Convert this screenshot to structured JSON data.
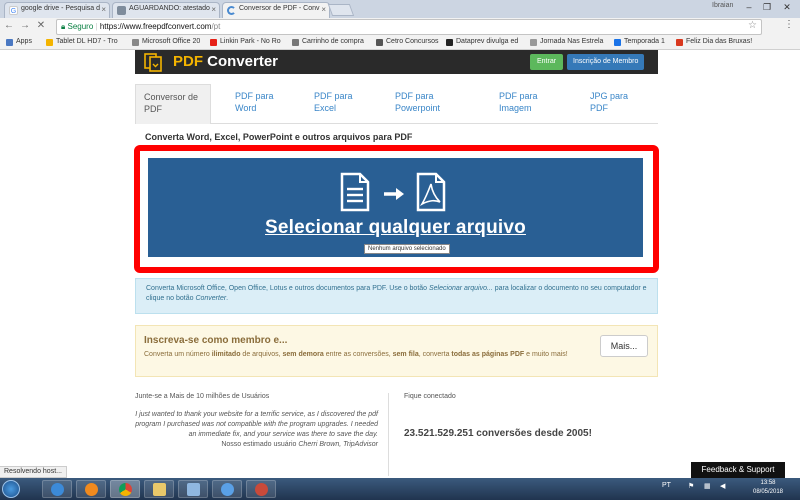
{
  "browser": {
    "tabs": [
      {
        "title": "google drive - Pesquisa d",
        "favicon": "google-icon"
      },
      {
        "title": "AGUARDANDO: atestado",
        "favicon": "doc-icon"
      },
      {
        "title": "Conversor de PDF - Conv",
        "favicon": "loading-icon",
        "active": true
      }
    ],
    "profile": "Ibraian",
    "secure_label": "Seguro",
    "url_host": "https://www.freepdfconvert.com",
    "url_path": "/pt",
    "bookmarks": [
      {
        "label": "Apps",
        "icon": "apps-grid-icon",
        "color": "#4a78c2"
      },
      {
        "label": "Tablet DL HD7 - Tro",
        "icon": "tablet-icon",
        "color": "#f4b400"
      },
      {
        "label": "Microsoft Office 20",
        "icon": "doc-icon",
        "color": "#888888"
      },
      {
        "label": "Linkin Park - No Ro",
        "icon": "youtube-icon",
        "color": "#e62117"
      },
      {
        "label": "Carrinho de compra",
        "icon": "cart-icon",
        "color": "#777777"
      },
      {
        "label": "Cetro Concursos",
        "icon": "bookmark-icon",
        "color": "#555555"
      },
      {
        "label": "Dataprev divulga ed",
        "icon": "bookmark-icon",
        "color": "#222222"
      },
      {
        "label": "Jornada Nas Estrela",
        "icon": "bookmark-icon",
        "color": "#999999"
      },
      {
        "label": "Temporada 1",
        "icon": "bookmark-icon",
        "color": "#1a73e8"
      },
      {
        "label": "Feliz Dia das Bruxas!",
        "icon": "bookmark-icon",
        "color": "#d9381e"
      }
    ]
  },
  "header": {
    "logo_pdf": "PDF",
    "logo_rest": " Converter",
    "login_label": "Entrar",
    "signup_label": "Inscrição de Membro"
  },
  "nav": {
    "tabs": [
      {
        "line1": "Conversor de",
        "line2": "PDF",
        "active": true
      },
      {
        "line1": "PDF para",
        "line2": "Word"
      },
      {
        "line1": "PDF para",
        "line2": "Excel"
      },
      {
        "line1": "PDF para",
        "line2": "Powerpoint"
      },
      {
        "line1": "PDF para",
        "line2": "Imagem"
      },
      {
        "line1": "JPG para",
        "line2": "PDF"
      }
    ]
  },
  "main": {
    "subtitle": "Converta Word, Excel, PowerPoint e outros arquivos para PDF",
    "upload_label": "Selecionar qualquer arquivo",
    "tooltip": "Nenhum arquivo selecionado",
    "info_part1": "Converta Microsoft Office, Open Office, Lotus e outros documentos para PDF. Use o botão ",
    "info_italic1": "Selecionar arquivo...",
    "info_part2": " para localizar o documento no seu computador e clique no botão ",
    "info_italic2": "Converter",
    "info_part3": "."
  },
  "promo": {
    "title": "Inscreva-se como membro e...",
    "text_a": "Converta um número ",
    "text_b": "ilimitado",
    "text_c": " de arquivos, ",
    "text_d": "sem demora",
    "text_e": " entre as conversões, ",
    "text_f": "sem fila",
    "text_g": ", converta ",
    "text_h": "todas as páginas PDF",
    "text_i": " e muito mais!",
    "more_label": "Mais..."
  },
  "footer": {
    "join_heading": "Junte-se a Mais de 10 milhões de Usuários",
    "testimonial": "I just wanted to thank your website for a terrific service, as I discovered the pdf program I purchased was not compatible with the program upgrades. I needed an immediate fix, and your service was there to save the day.",
    "signature_prefix": "Nosso estimado usuário ",
    "signature_name": "Cherri Brown, TripAdvisor",
    "connect_heading": "Fique conectado",
    "conversions": "23.521.529.251 conversões desde 2005!"
  },
  "status_text": "Resolvendo host...",
  "feedback_label": "Feedback & Support",
  "taskbar": {
    "lang": "PT",
    "time": "13:58",
    "date": "08/05/2018"
  }
}
